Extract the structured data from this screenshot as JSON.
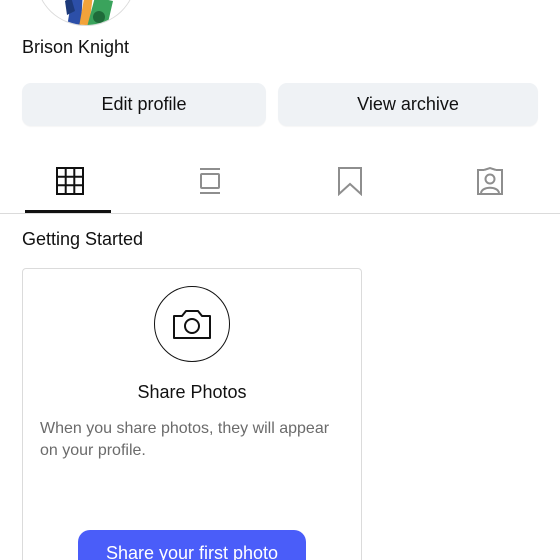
{
  "profile": {
    "name": "Brison Knight"
  },
  "actions": {
    "edit_label": "Edit profile",
    "archive_label": "View archive"
  },
  "tabs": [
    {
      "icon": "grid-icon",
      "active": true
    },
    {
      "icon": "feed-icon",
      "active": false
    },
    {
      "icon": "bookmark-icon",
      "active": false
    },
    {
      "icon": "tagged-person-icon",
      "active": false
    }
  ],
  "getting_started": {
    "title": "Getting Started",
    "card": {
      "icon": "camera-icon",
      "title": "Share Photos",
      "description": "When you share photos, they will appear on your profile.",
      "cta_label": "Share your first photo"
    }
  },
  "colors": {
    "accent": "#4a5df9",
    "button_bg": "#eff2f5",
    "divider": "#dbdbdb"
  }
}
